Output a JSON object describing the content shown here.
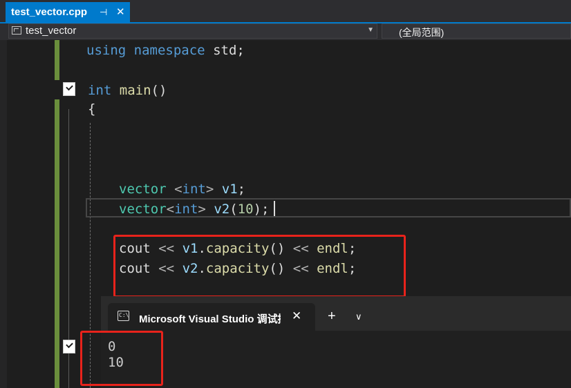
{
  "tab": {
    "title": "test_vector.cpp",
    "pin_glyph": "⊣",
    "close_glyph": "✕"
  },
  "nav": {
    "scope": "test_vector",
    "member": "(全局范围)"
  },
  "code": {
    "using_kw": "using",
    "namespace_kw": "namespace",
    "std_name": "std",
    "semi": ";",
    "int_kw": "int",
    "main_fn": "main",
    "parens": "()",
    "brace_open": "{",
    "vector_type": "vector",
    "lt": "<",
    "gt": ">",
    "v1": "v1",
    "v2": "v2",
    "ten": "10",
    "lparen": "(",
    "rparen": ")",
    "cout": "cout",
    "shl": "<<",
    "dot": ".",
    "capacity": "capacity",
    "endl": "endl"
  },
  "terminal": {
    "title": "Microsoft Visual Studio 调试控制台",
    "close_glyph": "✕",
    "new_tab_glyph": "+",
    "dropdown_glyph": "∨",
    "output": [
      "0",
      "10"
    ]
  },
  "colors": {
    "accent": "#007acc",
    "highlight_box": "#e8231b",
    "change_bar": "#6a8e3c",
    "keyword": "#569cd6",
    "type": "#4ec9b0",
    "function": "#dcdcaa",
    "number": "#b5cea8"
  }
}
